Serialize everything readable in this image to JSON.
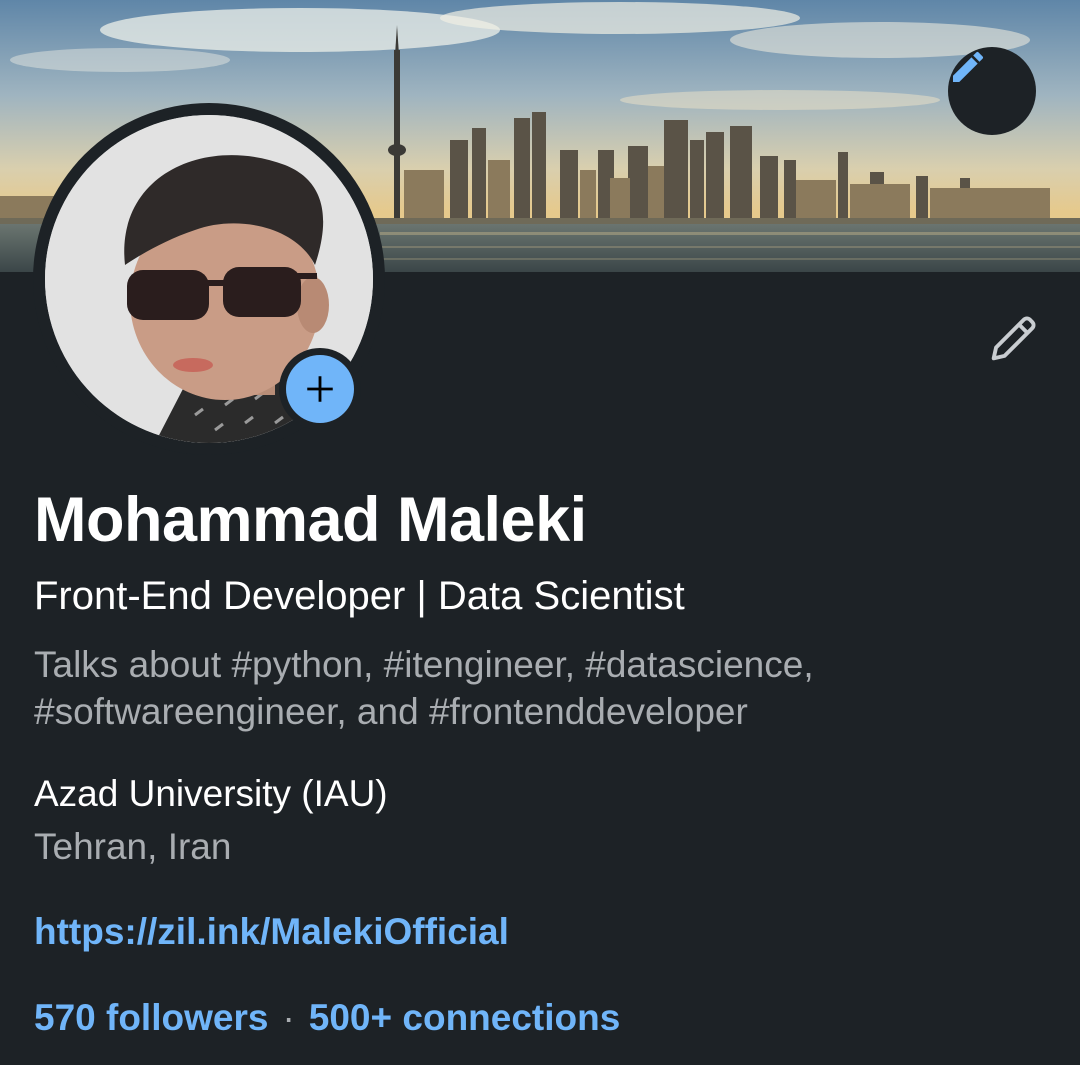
{
  "profile": {
    "name": "Mohammad Maleki",
    "headline": "Front-End Developer | Data Scientist",
    "talks_about": "Talks about #python, #itengineer, #datascience, #softwareengineer, and #frontenddeveloper",
    "education": "Azad University (IAU)",
    "location": "Tehran, Iran",
    "website": "https://zil.ink/MalekiOfficial",
    "followers": "570 followers",
    "separator": "·",
    "connections": "500+ connections"
  },
  "icons": {
    "cover_edit": "pencil-icon",
    "intro_edit": "pencil-outline-icon",
    "add_photo": "plus-icon"
  },
  "colors": {
    "background": "#1d2226",
    "accent": "#70b5f9",
    "primary_text": "#ffffff",
    "secondary_text": "#a9adb1"
  }
}
